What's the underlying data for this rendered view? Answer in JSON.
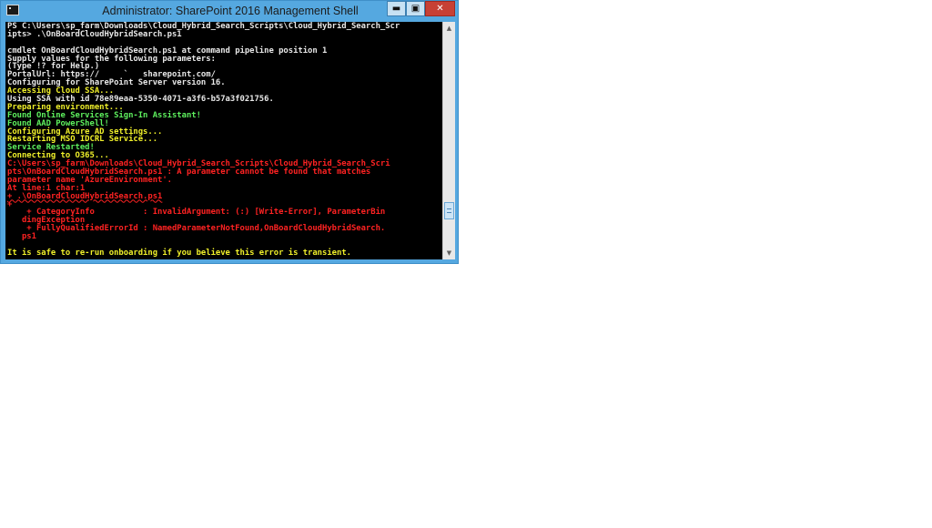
{
  "window": {
    "title": "Administrator: SharePoint 2016 Management Shell",
    "controls": {
      "minimize": "▬",
      "maximize": "▣",
      "close": "✕"
    },
    "icon": "powershell-console-icon"
  },
  "console": {
    "lines": [
      {
        "text": "PS C:\\Users\\sp_farm\\Downloads\\Cloud_Hybrid_Search_Scripts\\Cloud_Hybrid_Search_Scr",
        "color": "w"
      },
      {
        "text": "ipts> .\\OnBoardCloudHybridSearch.ps1",
        "color": "w"
      },
      {
        "text": "",
        "color": "w"
      },
      {
        "text": "cmdlet OnBoardCloudHybridSearch.ps1 at command pipeline position 1",
        "color": "w"
      },
      {
        "text": "Supply values for the following parameters:",
        "color": "w"
      },
      {
        "text": "(Type !? for Help.)",
        "color": "w"
      },
      {
        "text": "PortalUrl: https://     `   sharepoint.com/",
        "color": "w"
      },
      {
        "text": "Configuring for SharePoint Server version 16.",
        "color": "w"
      },
      {
        "text": "Accessing Cloud SSA...",
        "color": "y"
      },
      {
        "text": "Using SSA with id 78e89eaa-5350-4071-a3f6-b57a3f021756.",
        "color": "w"
      },
      {
        "text": "Preparing environment...",
        "color": "y"
      },
      {
        "text": "Found Online Services Sign-In Assistant!",
        "color": "g"
      },
      {
        "text": "Found AAD PowerShell!",
        "color": "g"
      },
      {
        "text": "Configuring Azure AD settings...",
        "color": "y"
      },
      {
        "text": "Restarting MSO IDCRL Service...",
        "color": "y"
      },
      {
        "text": "Service Restarted!",
        "color": "g"
      },
      {
        "text": "Connecting to O365...",
        "color": "y"
      },
      {
        "text": "C:\\Users\\sp_farm\\Downloads\\Cloud_Hybrid_Search_Scripts\\Cloud_Hybrid_Search_Scri",
        "color": "r"
      },
      {
        "text": "pts\\OnBoardCloudHybridSearch.ps1 : A parameter cannot be found that matches",
        "color": "r"
      },
      {
        "text": "parameter name 'AzureEnvironment'.",
        "color": "r"
      },
      {
        "text": "At line:1 char:1",
        "color": "r"
      },
      {
        "text": "+ .\\OnBoardCloudHybridSearch.ps1",
        "color": "r",
        "squiggle": true
      },
      {
        "text": "+ ",
        "color": "r"
      },
      {
        "text": "    + CategoryInfo          : InvalidArgument: (:) [Write-Error], ParameterBin",
        "color": "r"
      },
      {
        "text": "   dingException",
        "color": "r"
      },
      {
        "text": "    + FullyQualifiedErrorId : NamedParameterNotFound,OnBoardCloudHybridSearch.",
        "color": "r"
      },
      {
        "text": "   ps1",
        "color": "r"
      },
      {
        "text": "",
        "color": "w"
      },
      {
        "text": "It is safe to re-run onboarding if you believe this error is transient.",
        "color": "y"
      }
    ]
  },
  "scrollbar": {
    "up_arrow": "▲",
    "down_arrow": "▼",
    "position": 0.86
  }
}
